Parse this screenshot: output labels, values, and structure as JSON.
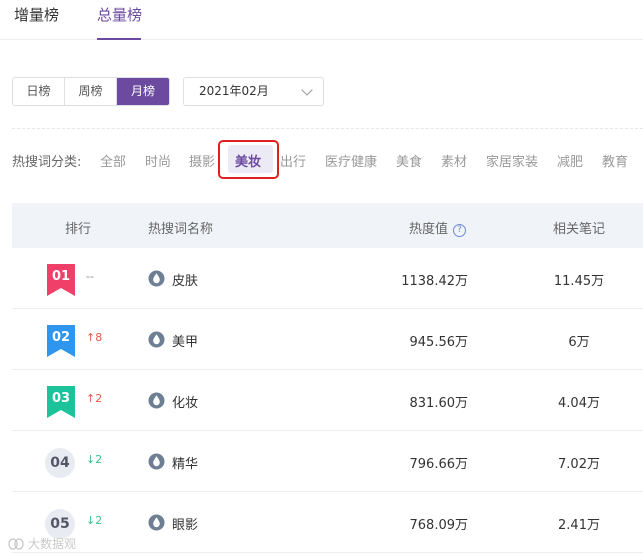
{
  "tabs": [
    {
      "label": "增量榜",
      "active": false
    },
    {
      "label": "总量榜",
      "active": true
    }
  ],
  "period": {
    "options": [
      "日榜",
      "周榜",
      "月榜"
    ],
    "active": "月榜"
  },
  "date_select": {
    "value": "2021年02月"
  },
  "category": {
    "label": "热搜词分类:",
    "items": [
      "全部",
      "时尚",
      "摄影",
      "美妆",
      "出行",
      "医疗健康",
      "美食",
      "素材",
      "家居家装",
      "减肥",
      "教育"
    ],
    "active": "美妆"
  },
  "table": {
    "headers": {
      "rank": "排行",
      "keyword": "热搜词名称",
      "heat": "热度值",
      "notes": "相关笔记"
    },
    "help_icon_glyph": "?",
    "rows": [
      {
        "rank": "01",
        "rank_style": "flag",
        "flag_color": "#f0406a",
        "trend": "--",
        "trend_dir": "flat",
        "keyword": "皮肤",
        "heat": "1138.42万",
        "notes": "11.45万"
      },
      {
        "rank": "02",
        "rank_style": "flag",
        "flag_color": "#2f96f0",
        "trend": "8",
        "trend_dir": "up",
        "keyword": "美甲",
        "heat": "945.56万",
        "notes": "6万"
      },
      {
        "rank": "03",
        "rank_style": "flag",
        "flag_color": "#1cc39a",
        "trend": "2",
        "trend_dir": "up",
        "keyword": "化妆",
        "heat": "831.60万",
        "notes": "4.04万"
      },
      {
        "rank": "04",
        "rank_style": "circle",
        "trend": "2",
        "trend_dir": "down",
        "keyword": "精华",
        "heat": "796.66万",
        "notes": "7.02万"
      },
      {
        "rank": "05",
        "rank_style": "circle",
        "trend": "2",
        "trend_dir": "down",
        "keyword": "眼影",
        "heat": "768.09万",
        "notes": "2.41万"
      }
    ]
  },
  "watermark": {
    "text": "大数据观",
    "icon": "logo-icon"
  },
  "colors": {
    "accent": "#6b4aa0",
    "highlight_box": "#e02020",
    "up": "#e05a4a",
    "down": "#3cbf8a",
    "drop_icon": "#6f7f93"
  }
}
